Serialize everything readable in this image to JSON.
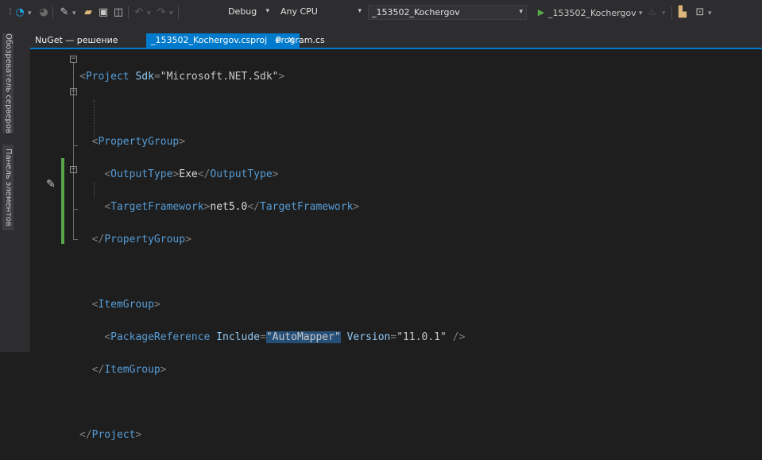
{
  "toolbar": {
    "config": "Debug",
    "platform": "Any CPU",
    "startup_project": "_153502_Kochergov",
    "run_label": "_153502_Kochergov"
  },
  "side_tabs": {
    "server_explorer": "Обозреватель серверов",
    "toolbox": "Панель элементов"
  },
  "tabs": [
    {
      "label": "NuGet — решение",
      "active": false
    },
    {
      "label": "_153502_Kochergov.csproj",
      "active": true,
      "pin": "⊕",
      "close": "✕"
    },
    {
      "label": "Program.cs",
      "active": false
    }
  ],
  "code": {
    "l1": {
      "tag": "Project",
      "attr": "Sdk",
      "val": "Microsoft.NET.Sdk"
    },
    "l3": {
      "tag": "PropertyGroup"
    },
    "l4": {
      "tag": "OutputType",
      "text": "Exe"
    },
    "l5": {
      "tag": "TargetFramework",
      "text": "net5.0"
    },
    "l6": {
      "tag": "PropertyGroup"
    },
    "l8": {
      "tag": "ItemGroup"
    },
    "l9": {
      "tag": "PackageReference",
      "attr1": "Include",
      "val1": "AutoMapper",
      "attr2": "Version",
      "val2": "11.0.1"
    },
    "l10": {
      "tag": "ItemGroup"
    },
    "l12": {
      "tag": "Project"
    }
  }
}
